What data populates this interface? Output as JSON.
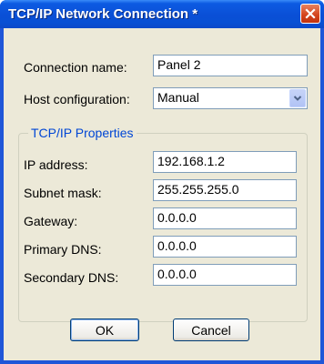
{
  "window": {
    "title": "TCP/IP Network Connection *"
  },
  "form": {
    "connection_name_label": "Connection name:",
    "connection_name_value": "Panel 2",
    "host_configuration_label": "Host configuration:",
    "host_configuration_value": "Manual"
  },
  "tcpip": {
    "group_title": "TCP/IP Properties",
    "fields": [
      {
        "label": "IP address:",
        "value": "192.168.1.2"
      },
      {
        "label": "Subnet mask:",
        "value": "255.255.255.0"
      },
      {
        "label": "Gateway:",
        "value": "0.0.0.0"
      },
      {
        "label": "Primary DNS:",
        "value": "0.0.0.0"
      },
      {
        "label": "Secondary DNS:",
        "value": "0.0.0.0"
      }
    ]
  },
  "buttons": {
    "ok_label": "OK",
    "cancel_label": "Cancel"
  },
  "icons": {
    "close": "close-icon",
    "dropdown": "chevron-down-icon"
  }
}
